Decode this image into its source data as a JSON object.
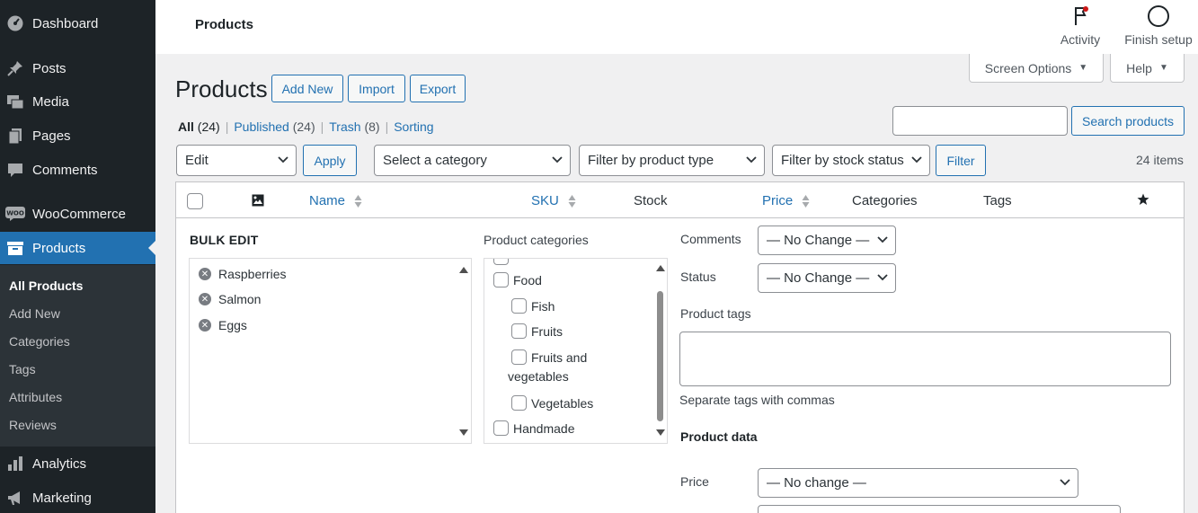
{
  "sidebar": {
    "items": [
      {
        "label": "Dashboard",
        "icon": "dashboard-icon"
      },
      {
        "label": "Posts",
        "icon": "pushpin-icon"
      },
      {
        "label": "Media",
        "icon": "media-icon"
      },
      {
        "label": "Pages",
        "icon": "pages-icon"
      },
      {
        "label": "Comments",
        "icon": "comment-icon"
      },
      {
        "label": "WooCommerce",
        "icon": "woo-icon"
      },
      {
        "label": "Products",
        "icon": "archive-icon"
      },
      {
        "label": "Analytics",
        "icon": "bar-chart-icon"
      },
      {
        "label": "Marketing",
        "icon": "megaphone-icon"
      }
    ],
    "submenu": [
      "All Products",
      "Add New",
      "Categories",
      "Tags",
      "Attributes",
      "Reviews"
    ]
  },
  "header": {
    "title": "Products",
    "activity_label": "Activity",
    "finish_setup_label": "Finish setup"
  },
  "screen_options_label": "Screen Options",
  "help_label": "Help",
  "page": {
    "title": "Products",
    "add_new": "Add New",
    "import": "Import",
    "export": "Export"
  },
  "views": [
    {
      "label": "All",
      "count": "(24)"
    },
    {
      "label": "Published",
      "count": "(24)"
    },
    {
      "label": "Trash",
      "count": "(8)"
    },
    {
      "label": "Sorting",
      "count": ""
    }
  ],
  "search": {
    "value": "",
    "button": "Search products"
  },
  "filters": {
    "bulk_action": "Edit",
    "apply": "Apply",
    "category": "Select a category",
    "product_type": "Filter by product type",
    "stock_status": "Filter by stock status",
    "filter": "Filter",
    "items_count": "24 items"
  },
  "table": {
    "columns": {
      "name": "Name",
      "sku": "SKU",
      "stock": "Stock",
      "price": "Price",
      "categories": "Categories",
      "tags": "Tags"
    }
  },
  "bulk_edit": {
    "title": "BULK EDIT",
    "products": [
      "Raspberries",
      "Salmon",
      "Eggs"
    ],
    "categories_label": "Product categories",
    "categories": [
      {
        "label": "Food",
        "level": 0
      },
      {
        "label": "Fish",
        "level": 1
      },
      {
        "label": "Fruits",
        "level": 1
      },
      {
        "label": "Fruits and",
        "label2": "vegetables",
        "level": 1
      },
      {
        "label": "Vegetables",
        "level": 1
      },
      {
        "label": "Handmade",
        "level": 0
      }
    ],
    "comments_label": "Comments",
    "comments_value": "— No Change —",
    "status_label": "Status",
    "status_value": "— No Change —",
    "tags_label": "Product tags",
    "tags_value": "",
    "tags_hint": "Separate tags with commas",
    "product_data_label": "Product data",
    "price_label": "Price",
    "price_value": "— No change —"
  },
  "colors": {
    "sidebar_bg": "#1d2327",
    "accent": "#2271b1",
    "page_bg": "#f0f0f1"
  }
}
